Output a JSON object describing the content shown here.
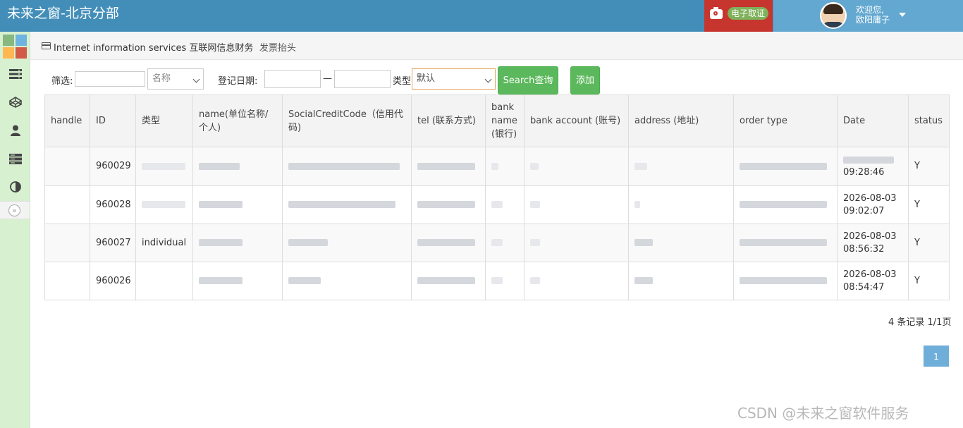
{
  "header": {
    "title": "未来之窗-北京分部",
    "evidence_label": "电子取证",
    "greeting_line1": "欢迎您,",
    "user_name": "欧阳庸子"
  },
  "colors": {
    "header_bg": "#438eb9",
    "evidence_bg": "#c6352e",
    "user_bg": "#62a8d1",
    "sidebar_bg": "#d7f0d0",
    "button_green": "#5cb85c",
    "pager_active": "#6faed9"
  },
  "sidebar": {
    "icons": [
      "grid-logo-icon",
      "list-icon",
      "codepen-icon",
      "user-icon",
      "storage-icon",
      "contrast-icon",
      "double-chevron-right-icon"
    ]
  },
  "breadcrumb": {
    "root": "Internet information services 互联网信息财务",
    "current": "发票抬头"
  },
  "filter": {
    "label": "筛选:",
    "keyword_value": "",
    "field_select": "名称",
    "date_label": "登记日期:",
    "date_from": "",
    "date_sep": "—",
    "date_to": "",
    "type_label": "类型",
    "type_select": "默认",
    "search_button": "Search查询",
    "add_button": "添加"
  },
  "table": {
    "columns": [
      "handle",
      "ID",
      "类型",
      "name(单位名称/个人)",
      "SocialCreditCode（信用代码)",
      "tel (联系方式)",
      "bank name (银行)",
      "bank account (账号)",
      "address (地址)",
      "order type",
      "Date",
      "status"
    ],
    "rows": [
      {
        "id": "960029",
        "type": "",
        "order_type": "",
        "date": "09:28:46",
        "status": "Y"
      },
      {
        "id": "960028",
        "type": "",
        "order_type": "",
        "date": "2026-08-03 09:02:07",
        "status": "Y"
      },
      {
        "id": "960027",
        "type": "individual",
        "order_type": "",
        "date": "2026-08-03 08:56:32",
        "status": "Y"
      },
      {
        "id": "960026",
        "type": "",
        "order_type": "",
        "date": "2026-08-03 08:54:47",
        "status": "Y"
      }
    ]
  },
  "pagination": {
    "summary": "4 条记录 1/1页",
    "current_page": "1"
  },
  "watermark": "CSDN @未来之窗软件服务"
}
